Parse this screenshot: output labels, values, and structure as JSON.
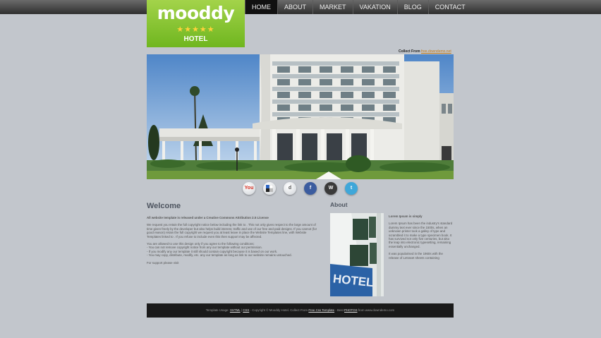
{
  "logo": {
    "name": "mooddy",
    "stars": "★★★★★",
    "subtitle": "HOTEL"
  },
  "nav": {
    "items": [
      "HOME",
      "ABOUT",
      "MARKET",
      "VAKATION",
      "BLOG",
      "CONTACT"
    ]
  },
  "collect": {
    "label": "Collect From",
    "link": "free.downdemo.net"
  },
  "social": {
    "icons": [
      "YouTube",
      "Delicious",
      "Digg",
      "Facebook",
      "WordPress",
      "Twitter"
    ]
  },
  "welcome": {
    "title": "Welcome",
    "license": "All website template is released under a Creative Commons Attribution 2.5 License",
    "p1": "We request you retain the full copyright notice below including the link to . This not only gives respect to the large amount of time given freely by the developer but also helps build interest, traffic and use of our free and paid designs. If you cannot (for good reason) retain the full copyright we request you at least leave in place the Website Templates line, with Website Templates linked to . If you refuse to include even this then support may be affected.",
    "p2a": "You are allowed to use this design only if you agree to the following conditions:",
    "p2b": "- You can not remove copyright notice from any our template without our permission.",
    "p2c": "- If you modify any our template it still should contain copyright because it is based on our work.",
    "p2d": "- You may copy, distribute, modify, etc. any our template as long as link to our website remains untouched.",
    "p3": "For support please visit"
  },
  "about": {
    "title": "About",
    "heading": "Lorem Ipsum is simply",
    "p1": "Lorem Ipsum has been the industry's standard dummy text ever since the 1500s, when an unknown printer took a galley of type and scrambled it to make a type specimen book. It has survived not only five centuries, but also the leap into electronic typesetting, remaining essentially unchanged.",
    "p2": "It was popularised in the 1960s with the release of Letraset sheets containing",
    "img_label": "HOTEL"
  },
  "footer": {
    "a": "Template Usage:",
    "b": "XHTML",
    "c": "|",
    "d": "CSS",
    "e": "- Copyright © Mooddy Hotel. Collect From",
    "f": "Free Css Template",
    "g": "- Best",
    "h": "PHOTOS",
    "i": "from www.downdemo.com"
  }
}
